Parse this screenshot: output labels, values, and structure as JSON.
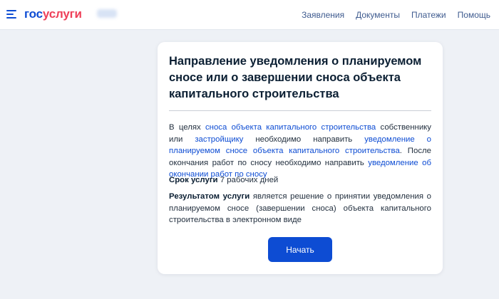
{
  "header": {
    "logo_part1": "гос",
    "logo_part2": "услуги",
    "nav": [
      "Заявления",
      "Документы",
      "Платежи",
      "Помощь"
    ],
    "colors": {
      "brand_blue": "#0d4cd3",
      "brand_red": "#ee3f58"
    }
  },
  "service": {
    "title": "Направление уведомления о планируемом сносе или о завершении сноса объекта капитального строительства",
    "desc": {
      "t1": "В целях ",
      "link1": "сноса объекта капитального строительства",
      "t2": " собственнику или ",
      "link2": "застройщику",
      "t3": " необходимо направить ",
      "link3": "уведомление о планируемом сносе объекта капитального строительства",
      "t4": ". После окончания работ по сносу необходимо направить ",
      "link4": "уведомление об окончании работ по сносу"
    },
    "term_label": "Срок услуги",
    "term_value": " 7 рабочих дней",
    "result_label": "Результатом услуги",
    "result_text": " является решение о принятии уведомления о планируемом сносе (завершении сноса) объекта капитального строительства в электронном виде",
    "start_button": "Начать"
  }
}
